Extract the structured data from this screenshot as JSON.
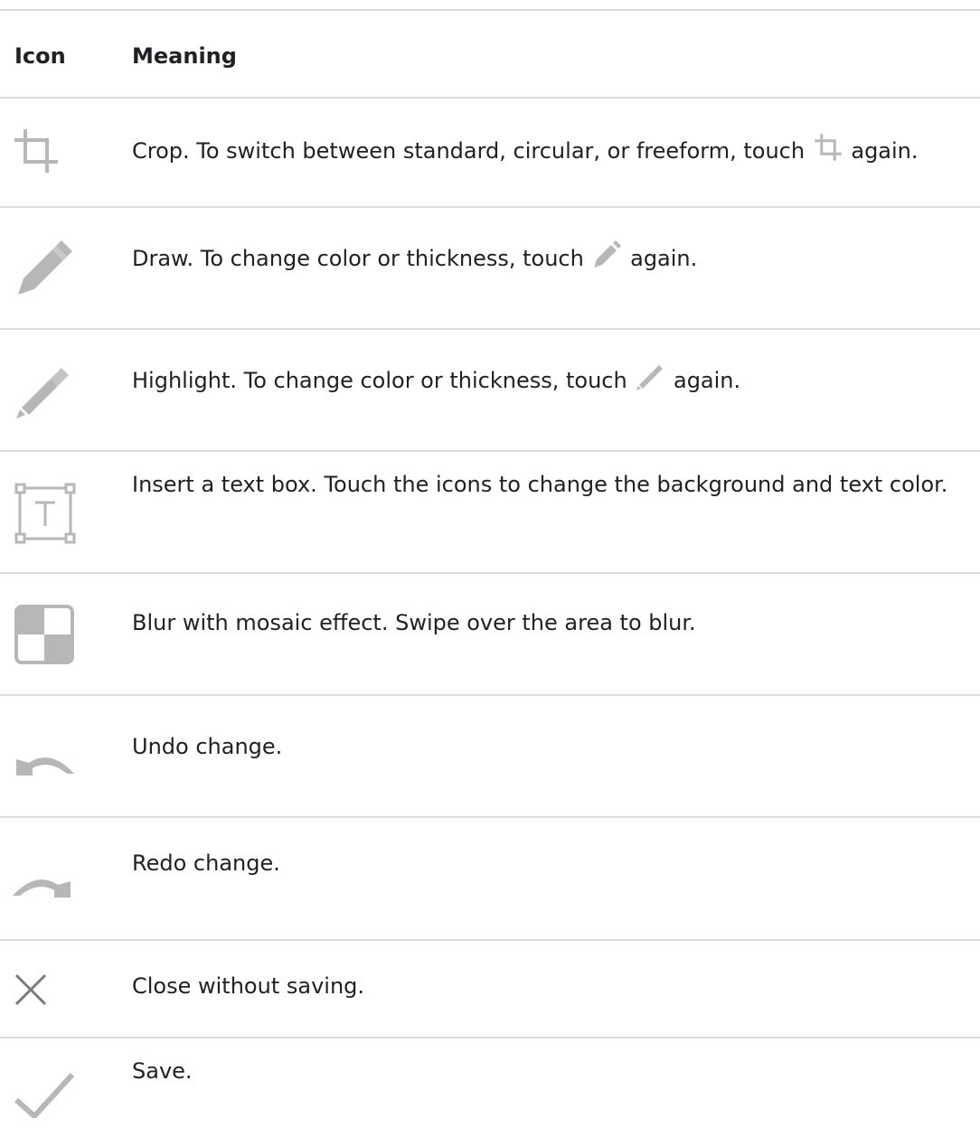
{
  "table": {
    "headers": {
      "icon": "Icon",
      "meaning": "Meaning"
    },
    "rows": [
      {
        "icon": "crop-icon",
        "text_before": "Crop. To switch between standard, circular, or freeform, touch",
        "inline_icon": "crop-icon",
        "text_after": "again."
      },
      {
        "icon": "draw-pen-icon",
        "text_before": "Draw. To change color or thickness, touch",
        "inline_icon": "draw-pen-icon",
        "text_after": "again."
      },
      {
        "icon": "highlighter-icon",
        "text_before": "Highlight. To change color or thickness, touch",
        "inline_icon": "highlighter-icon",
        "text_after": "again."
      },
      {
        "icon": "text-box-icon",
        "text": "Insert a text box. Touch the icons to change the background and text color."
      },
      {
        "icon": "mosaic-blur-icon",
        "text": "Blur with mosaic effect. Swipe over the area to blur."
      },
      {
        "icon": "undo-icon",
        "text": "Undo change."
      },
      {
        "icon": "redo-icon",
        "text": "Redo change."
      },
      {
        "icon": "close-icon",
        "text": "Close without saving."
      },
      {
        "icon": "check-icon",
        "text": "Save."
      }
    ]
  },
  "colors": {
    "text": "#202124",
    "rule": "#dadce0",
    "icon": "#b7b7b7"
  }
}
